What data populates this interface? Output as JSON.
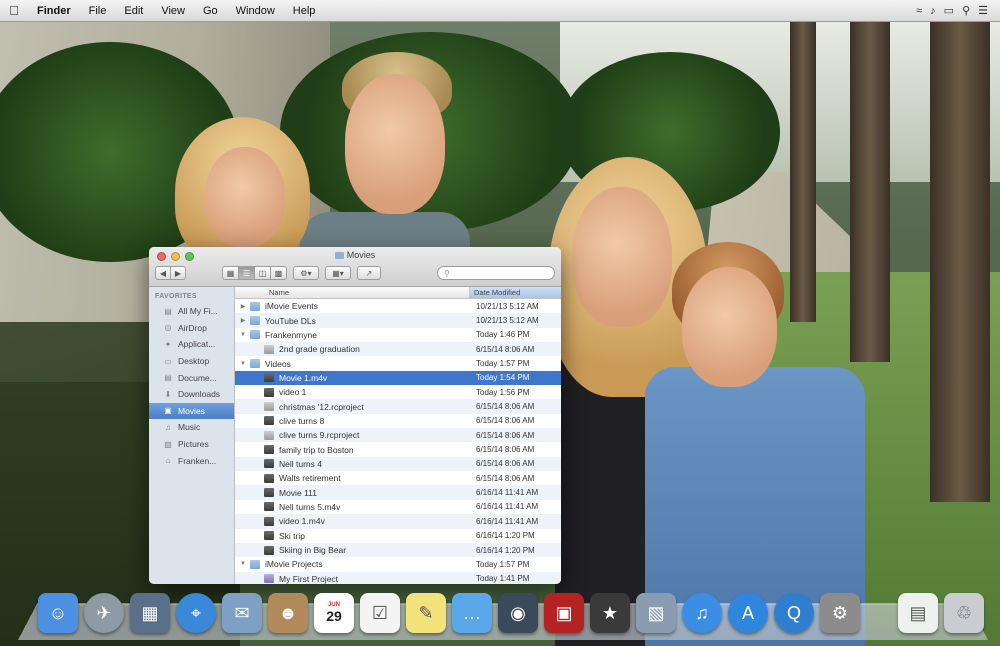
{
  "menubar": {
    "apple_icon": "apple-icon",
    "items": [
      "Finder",
      "File",
      "Edit",
      "View",
      "Go",
      "Window",
      "Help"
    ],
    "right_icons": [
      "wifi-icon",
      "volume-icon",
      "battery-icon",
      "spotlight-icon",
      "notification-icon"
    ]
  },
  "window": {
    "title": "Movies",
    "search_placeholder": "",
    "columns": {
      "name": "Name",
      "date": "Date Modified"
    }
  },
  "sidebar": {
    "heading": "FAVORITES",
    "items": [
      {
        "label": "All My Fi...",
        "icon": "all-files-icon"
      },
      {
        "label": "AirDrop",
        "icon": "airdrop-icon"
      },
      {
        "label": "Applicat...",
        "icon": "applications-icon"
      },
      {
        "label": "Desktop",
        "icon": "desktop-icon"
      },
      {
        "label": "Docume...",
        "icon": "documents-icon"
      },
      {
        "label": "Downloads",
        "icon": "downloads-icon"
      },
      {
        "label": "Movies",
        "icon": "movies-icon",
        "selected": true
      },
      {
        "label": "Music",
        "icon": "music-icon"
      },
      {
        "label": "Pictures",
        "icon": "pictures-icon"
      },
      {
        "label": "Franken...",
        "icon": "home-icon"
      }
    ]
  },
  "files": [
    {
      "name": "iMovie Events",
      "date": "10/21/13 5:12 AM",
      "depth": 0,
      "disclosure": "right",
      "icon": "folder"
    },
    {
      "name": "YouTube DLs",
      "date": "10/21/13 5:12 AM",
      "depth": 0,
      "disclosure": "right",
      "icon": "folder"
    },
    {
      "name": "Frankenmyne",
      "date": "Today 1:46 PM",
      "depth": 0,
      "disclosure": "down",
      "icon": "folder"
    },
    {
      "name": "2nd grade graduation",
      "date": "6/15/14 8:06 AM",
      "depth": 1,
      "disclosure": "",
      "icon": "proj"
    },
    {
      "name": "Videos",
      "date": "Today 1:57 PM",
      "depth": 0,
      "disclosure": "down",
      "icon": "folder"
    },
    {
      "name": "Movie 1.m4v",
      "date": "Today 1:54 PM",
      "depth": 1,
      "disclosure": "",
      "icon": "film",
      "selected": true
    },
    {
      "name": "video 1",
      "date": "Today 1:56 PM",
      "depth": 1,
      "disclosure": "",
      "icon": "film"
    },
    {
      "name": "christmas '12.rcproject",
      "date": "6/15/14 8:06 AM",
      "depth": 1,
      "disclosure": "",
      "icon": "proj"
    },
    {
      "name": "clive turns 8",
      "date": "6/15/14 8:06 AM",
      "depth": 1,
      "disclosure": "",
      "icon": "film"
    },
    {
      "name": "clive turns 9.rcproject",
      "date": "6/15/14 8:06 AM",
      "depth": 1,
      "disclosure": "",
      "icon": "proj"
    },
    {
      "name": "family trip to Boston",
      "date": "6/15/14 8:06 AM",
      "depth": 1,
      "disclosure": "",
      "icon": "film"
    },
    {
      "name": "Nell turns 4",
      "date": "6/15/14 8:06 AM",
      "depth": 1,
      "disclosure": "",
      "icon": "film"
    },
    {
      "name": "Walts retirement",
      "date": "6/15/14 8:06 AM",
      "depth": 1,
      "disclosure": "",
      "icon": "film"
    },
    {
      "name": "Movie 111",
      "date": "6/16/14 11:41 AM",
      "depth": 1,
      "disclosure": "",
      "icon": "film"
    },
    {
      "name": "Nell turns 5.m4v",
      "date": "6/16/14 11:41 AM",
      "depth": 1,
      "disclosure": "",
      "icon": "film"
    },
    {
      "name": "video 1.m4v",
      "date": "6/16/14 11:41 AM",
      "depth": 1,
      "disclosure": "",
      "icon": "film"
    },
    {
      "name": "Ski trip",
      "date": "6/16/14 1:20 PM",
      "depth": 1,
      "disclosure": "",
      "icon": "film"
    },
    {
      "name": "Skiing in Big Bear",
      "date": "6/16/14 1:20 PM",
      "depth": 1,
      "disclosure": "",
      "icon": "film"
    },
    {
      "name": "iMovie Projects",
      "date": "Today 1:57 PM",
      "depth": 0,
      "disclosure": "down",
      "icon": "folder"
    },
    {
      "name": "My First Project",
      "date": "Today 1:41 PM",
      "depth": 1,
      "disclosure": "",
      "icon": "proj2"
    }
  ],
  "dock": {
    "items": [
      {
        "name": "finder-icon",
        "color": "#4d8fe0"
      },
      {
        "name": "launchpad-icon",
        "color": "#8e9aa6"
      },
      {
        "name": "mission-control-icon",
        "color": "#5a6f8a"
      },
      {
        "name": "safari-icon",
        "color": "#3a89d8"
      },
      {
        "name": "mail-icon",
        "color": "#7ea0c4"
      },
      {
        "name": "contacts-icon",
        "color": "#b08a5a"
      },
      {
        "name": "calendar-icon",
        "color": "#ffffff",
        "day": "29",
        "month": "JUN"
      },
      {
        "name": "reminders-icon",
        "color": "#f4f4f4"
      },
      {
        "name": "notes-icon",
        "color": "#f1e27a"
      },
      {
        "name": "messages-icon",
        "color": "#5aa7ea"
      },
      {
        "name": "facetime-icon",
        "color": "#3a4a5a"
      },
      {
        "name": "photo-booth-icon",
        "color": "#b52222"
      },
      {
        "name": "imovie-icon",
        "color": "#3a3a3a"
      },
      {
        "name": "iphoto-icon",
        "color": "#8a9db0"
      },
      {
        "name": "itunes-icon",
        "color": "#3a8ee6"
      },
      {
        "name": "app-store-icon",
        "color": "#2f86de"
      },
      {
        "name": "quicktime-icon",
        "color": "#2f7fd0"
      },
      {
        "name": "system-preferences-icon",
        "color": "#8c8c8c"
      },
      {
        "name": "document-icon",
        "color": "#eef2ee"
      },
      {
        "name": "trash-icon",
        "color": "#c9cdd2"
      }
    ]
  }
}
